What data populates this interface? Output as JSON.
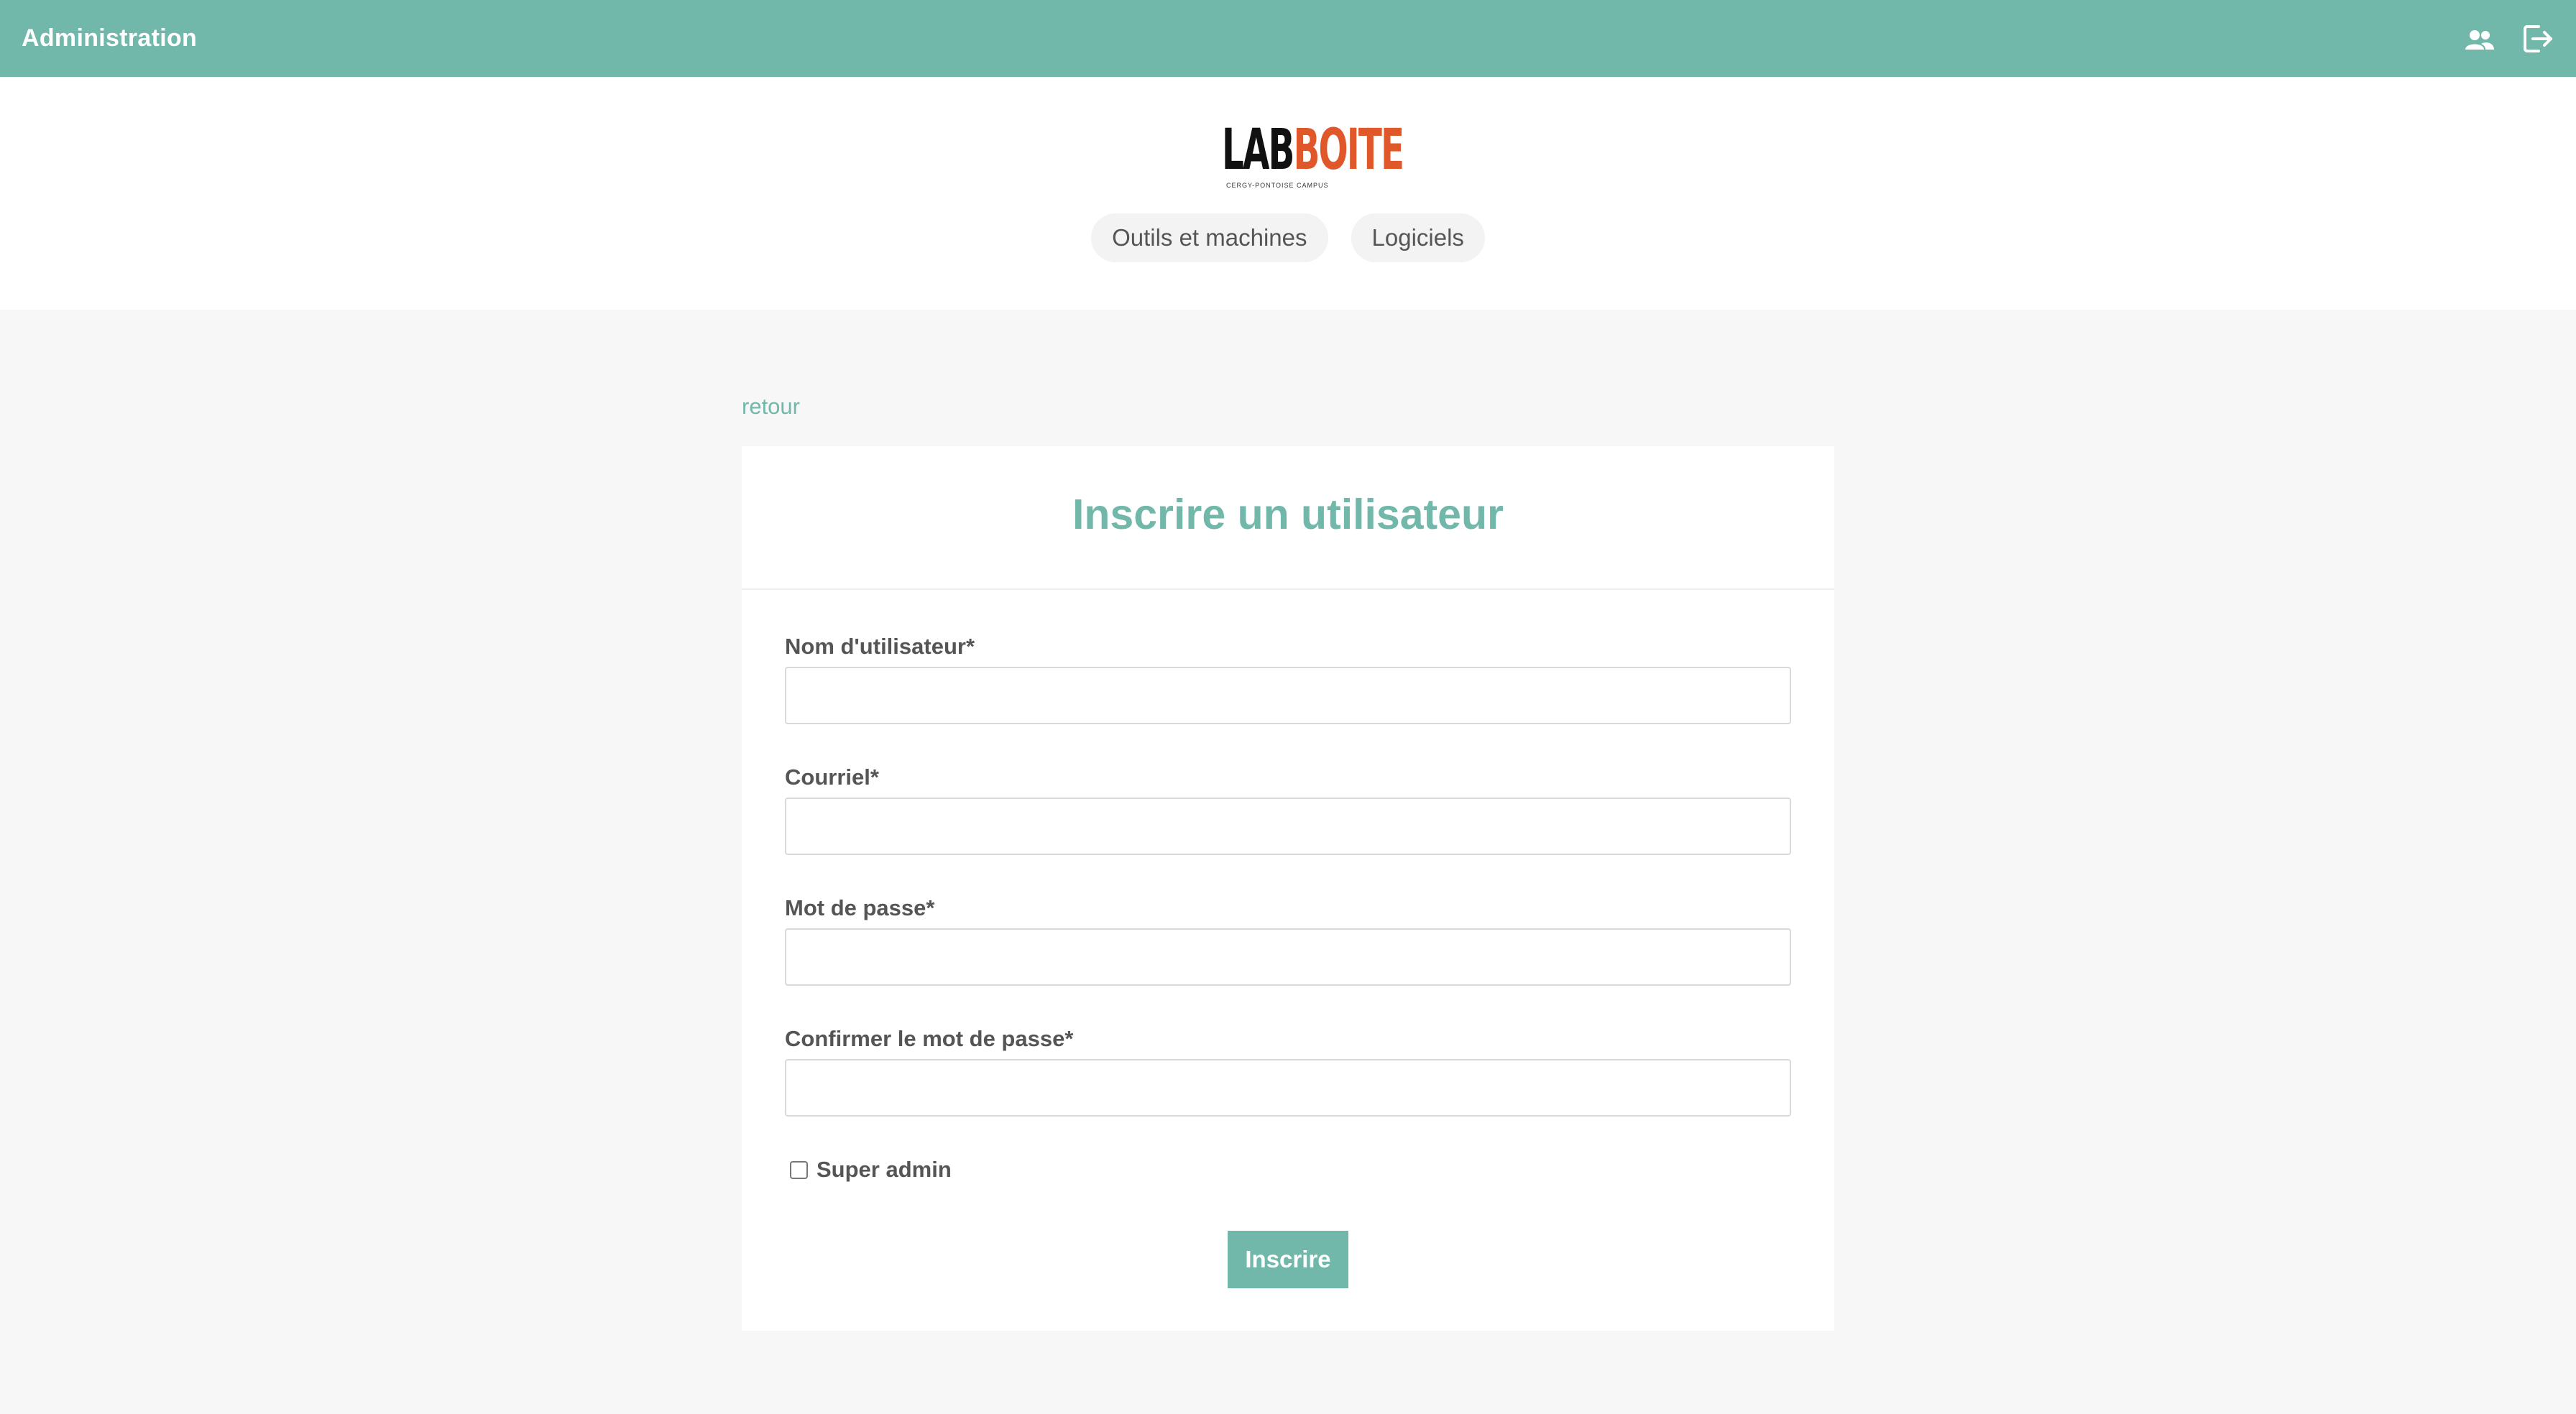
{
  "topbar": {
    "title": "Administration",
    "icons": [
      "users-icon",
      "logout-icon"
    ],
    "accent_color": "#72b8aa"
  },
  "logo": {
    "text_lab": "LAB",
    "text_boite": "BOITE",
    "subtitle": "CERGY-PONTOISE CAMPUS",
    "colors": {
      "lab": "#111111",
      "boite": "#e0572a"
    }
  },
  "nav": {
    "items": [
      {
        "label": "Outils et machines"
      },
      {
        "label": "Logiciels"
      }
    ]
  },
  "back_link": "retour",
  "form": {
    "title": "Inscrire un utilisateur",
    "fields": [
      {
        "label": "Nom d'utilisateur*",
        "value": "",
        "placeholder": ""
      },
      {
        "label": "Courriel*",
        "value": "",
        "placeholder": ""
      },
      {
        "label": "Mot de passe*",
        "value": "",
        "placeholder": ""
      },
      {
        "label": "Confirmer le mot de passe*",
        "value": "",
        "placeholder": ""
      }
    ],
    "checkbox": {
      "label": "Super admin",
      "checked": false
    },
    "submit_label": "Inscrire"
  }
}
